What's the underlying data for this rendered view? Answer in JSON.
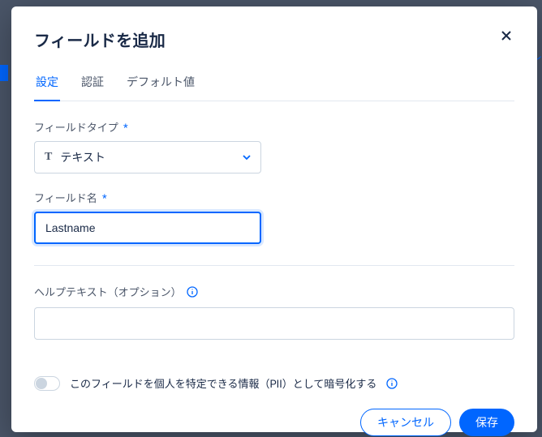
{
  "modal": {
    "title": "フィールドを追加"
  },
  "tabs": {
    "settings": "設定",
    "auth": "認証",
    "default": "デフォルト値"
  },
  "form": {
    "field_type_label": "フィールドタイプ",
    "field_type_value": "テキスト",
    "field_name_label": "フィールド名",
    "field_name_value": "Lastname",
    "help_text_label": "ヘルプテキスト（オプション）",
    "help_text_value": "",
    "pii_toggle_label": "このフィールドを個人を特定できる情報（PII）として暗号化する"
  },
  "footer": {
    "cancel": "キャンセル",
    "save": "保存"
  },
  "required_mark": "*",
  "colors": {
    "accent": "#0066ff"
  }
}
